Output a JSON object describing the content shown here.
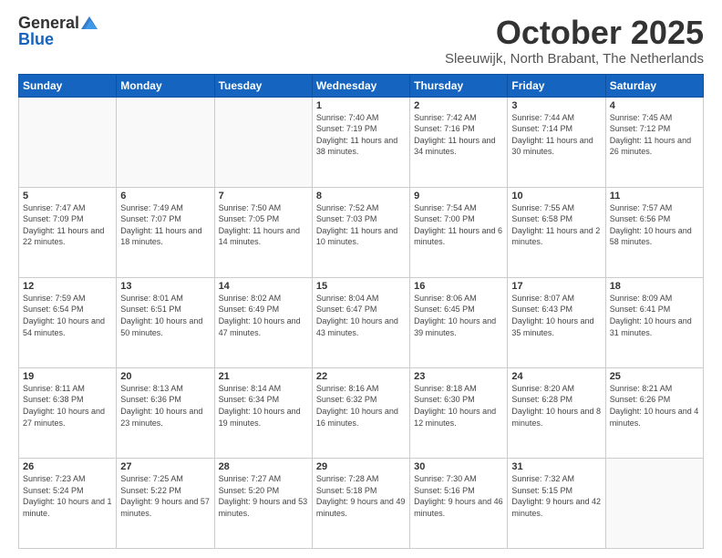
{
  "header": {
    "logo_general": "General",
    "logo_blue": "Blue",
    "month": "October 2025",
    "location": "Sleeuwijk, North Brabant, The Netherlands"
  },
  "weekdays": [
    "Sunday",
    "Monday",
    "Tuesday",
    "Wednesday",
    "Thursday",
    "Friday",
    "Saturday"
  ],
  "weeks": [
    [
      {
        "day": "",
        "info": ""
      },
      {
        "day": "",
        "info": ""
      },
      {
        "day": "",
        "info": ""
      },
      {
        "day": "1",
        "info": "Sunrise: 7:40 AM\nSunset: 7:19 PM\nDaylight: 11 hours\nand 38 minutes."
      },
      {
        "day": "2",
        "info": "Sunrise: 7:42 AM\nSunset: 7:16 PM\nDaylight: 11 hours\nand 34 minutes."
      },
      {
        "day": "3",
        "info": "Sunrise: 7:44 AM\nSunset: 7:14 PM\nDaylight: 11 hours\nand 30 minutes."
      },
      {
        "day": "4",
        "info": "Sunrise: 7:45 AM\nSunset: 7:12 PM\nDaylight: 11 hours\nand 26 minutes."
      }
    ],
    [
      {
        "day": "5",
        "info": "Sunrise: 7:47 AM\nSunset: 7:09 PM\nDaylight: 11 hours\nand 22 minutes."
      },
      {
        "day": "6",
        "info": "Sunrise: 7:49 AM\nSunset: 7:07 PM\nDaylight: 11 hours\nand 18 minutes."
      },
      {
        "day": "7",
        "info": "Sunrise: 7:50 AM\nSunset: 7:05 PM\nDaylight: 11 hours\nand 14 minutes."
      },
      {
        "day": "8",
        "info": "Sunrise: 7:52 AM\nSunset: 7:03 PM\nDaylight: 11 hours\nand 10 minutes."
      },
      {
        "day": "9",
        "info": "Sunrise: 7:54 AM\nSunset: 7:00 PM\nDaylight: 11 hours\nand 6 minutes."
      },
      {
        "day": "10",
        "info": "Sunrise: 7:55 AM\nSunset: 6:58 PM\nDaylight: 11 hours\nand 2 minutes."
      },
      {
        "day": "11",
        "info": "Sunrise: 7:57 AM\nSunset: 6:56 PM\nDaylight: 10 hours\nand 58 minutes."
      }
    ],
    [
      {
        "day": "12",
        "info": "Sunrise: 7:59 AM\nSunset: 6:54 PM\nDaylight: 10 hours\nand 54 minutes."
      },
      {
        "day": "13",
        "info": "Sunrise: 8:01 AM\nSunset: 6:51 PM\nDaylight: 10 hours\nand 50 minutes."
      },
      {
        "day": "14",
        "info": "Sunrise: 8:02 AM\nSunset: 6:49 PM\nDaylight: 10 hours\nand 47 minutes."
      },
      {
        "day": "15",
        "info": "Sunrise: 8:04 AM\nSunset: 6:47 PM\nDaylight: 10 hours\nand 43 minutes."
      },
      {
        "day": "16",
        "info": "Sunrise: 8:06 AM\nSunset: 6:45 PM\nDaylight: 10 hours\nand 39 minutes."
      },
      {
        "day": "17",
        "info": "Sunrise: 8:07 AM\nSunset: 6:43 PM\nDaylight: 10 hours\nand 35 minutes."
      },
      {
        "day": "18",
        "info": "Sunrise: 8:09 AM\nSunset: 6:41 PM\nDaylight: 10 hours\nand 31 minutes."
      }
    ],
    [
      {
        "day": "19",
        "info": "Sunrise: 8:11 AM\nSunset: 6:38 PM\nDaylight: 10 hours\nand 27 minutes."
      },
      {
        "day": "20",
        "info": "Sunrise: 8:13 AM\nSunset: 6:36 PM\nDaylight: 10 hours\nand 23 minutes."
      },
      {
        "day": "21",
        "info": "Sunrise: 8:14 AM\nSunset: 6:34 PM\nDaylight: 10 hours\nand 19 minutes."
      },
      {
        "day": "22",
        "info": "Sunrise: 8:16 AM\nSunset: 6:32 PM\nDaylight: 10 hours\nand 16 minutes."
      },
      {
        "day": "23",
        "info": "Sunrise: 8:18 AM\nSunset: 6:30 PM\nDaylight: 10 hours\nand 12 minutes."
      },
      {
        "day": "24",
        "info": "Sunrise: 8:20 AM\nSunset: 6:28 PM\nDaylight: 10 hours\nand 8 minutes."
      },
      {
        "day": "25",
        "info": "Sunrise: 8:21 AM\nSunset: 6:26 PM\nDaylight: 10 hours\nand 4 minutes."
      }
    ],
    [
      {
        "day": "26",
        "info": "Sunrise: 7:23 AM\nSunset: 5:24 PM\nDaylight: 10 hours\nand 1 minute."
      },
      {
        "day": "27",
        "info": "Sunrise: 7:25 AM\nSunset: 5:22 PM\nDaylight: 9 hours\nand 57 minutes."
      },
      {
        "day": "28",
        "info": "Sunrise: 7:27 AM\nSunset: 5:20 PM\nDaylight: 9 hours\nand 53 minutes."
      },
      {
        "day": "29",
        "info": "Sunrise: 7:28 AM\nSunset: 5:18 PM\nDaylight: 9 hours\nand 49 minutes."
      },
      {
        "day": "30",
        "info": "Sunrise: 7:30 AM\nSunset: 5:16 PM\nDaylight: 9 hours\nand 46 minutes."
      },
      {
        "day": "31",
        "info": "Sunrise: 7:32 AM\nSunset: 5:15 PM\nDaylight: 9 hours\nand 42 minutes."
      },
      {
        "day": "",
        "info": ""
      }
    ]
  ]
}
